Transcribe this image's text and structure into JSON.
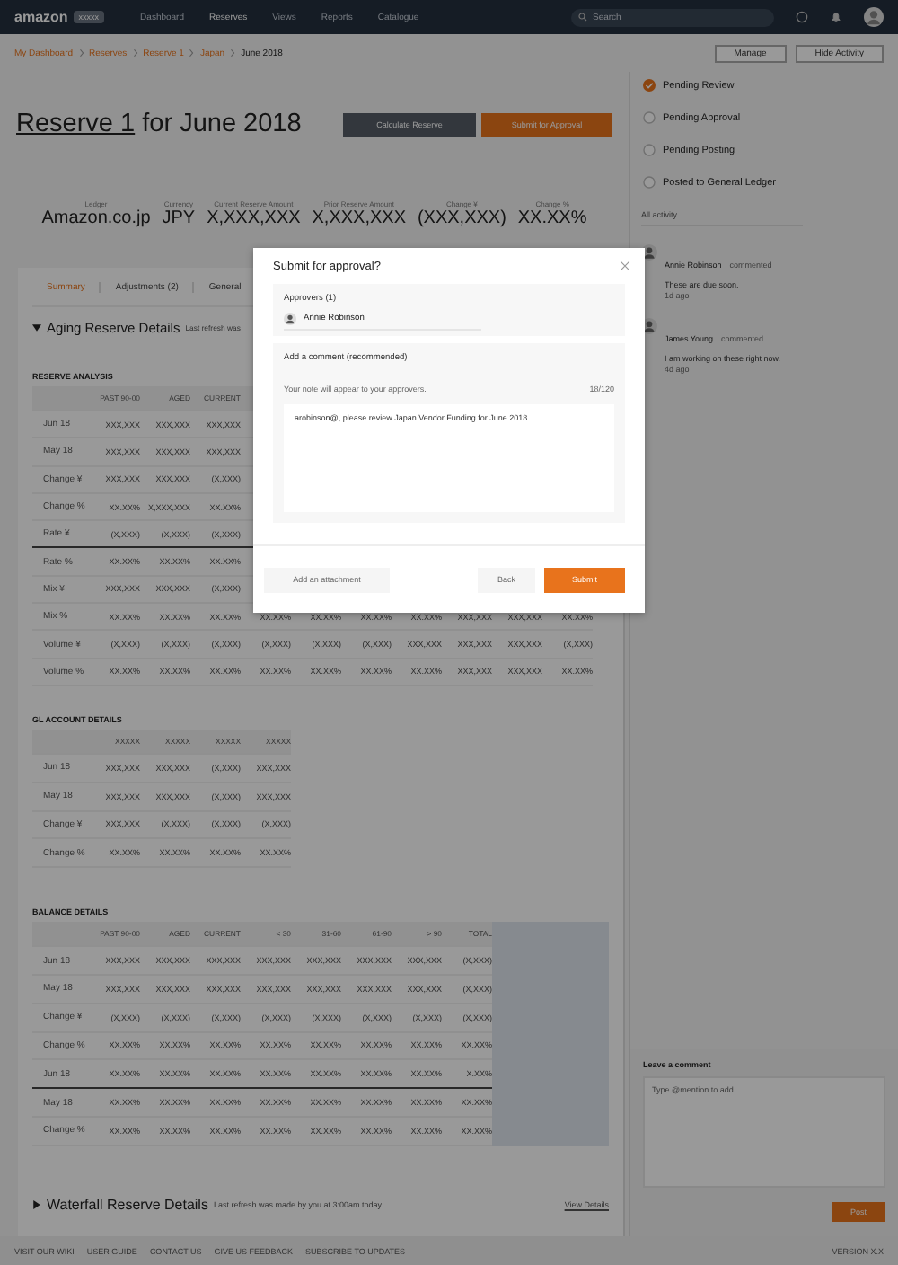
{
  "nav": {
    "logo": "amazon",
    "logo_badge": "xxxxx",
    "items": [
      {
        "label": "Dashboard",
        "selected": false
      },
      {
        "label": "Reserves",
        "selected": true
      },
      {
        "label": "Views",
        "selected": false
      },
      {
        "label": "Reports",
        "selected": false
      },
      {
        "label": "Catalogue",
        "selected": false
      }
    ],
    "search": {
      "placeholder": "Search"
    }
  },
  "breadcrumb": [
    {
      "label": "My Dashboard"
    },
    {
      "label": "Reserves"
    },
    {
      "label": "Reserve 1"
    },
    {
      "label": "Japan"
    },
    {
      "label": "June 2018"
    }
  ],
  "toolbar_buttons": [
    "Manage",
    "Hide Activity"
  ],
  "title": {
    "link": "Reserve 1",
    "rest": "for June 2018"
  },
  "actions": [
    {
      "label": "Calculate Reserve",
      "kind": "secondary"
    },
    {
      "label": "Submit for Approval",
      "kind": "primary"
    }
  ],
  "stats": [
    {
      "label": "Ledger",
      "value": "Amazon.co.jp"
    },
    {
      "label": "Currency",
      "value": "JPY"
    },
    {
      "label": "Current Reserve Amount",
      "value": "X,XXX,XXX"
    },
    {
      "label": "Prior Reserve Amount",
      "value": "X,XXX,XXX"
    },
    {
      "label": "Change ¥",
      "value": "(XXX,XXX)"
    },
    {
      "label": "Change %",
      "value": "XX.XX%"
    }
  ],
  "tabs": [
    {
      "label": "Summary",
      "selected": true
    },
    {
      "label": "Adjustments (2)",
      "selected": false
    },
    {
      "label": "General",
      "selected": false
    }
  ],
  "aging": {
    "title": "Aging Reserve Details",
    "note": "Last refresh was"
  },
  "sections": [
    {
      "title": "RESERVE ANALYSIS",
      "shaded_panel": false,
      "columns": [
        "PAST 90-00",
        "AGED",
        "CURRENT"
      ],
      "rows": [
        {
          "label": "Jun 18",
          "divider": false,
          "cells": [
            "XXX,XXX",
            "XXX,XXX",
            "XXX,XXX"
          ]
        },
        {
          "label": "May 18",
          "divider": false,
          "cells": [
            "XXX,XXX",
            "XXX,XXX",
            "XXX,XXX"
          ]
        },
        {
          "label": "Change ¥",
          "divider": false,
          "cells": [
            "XXX,XXX",
            "XXX,XXX",
            "(X,XXX)"
          ]
        },
        {
          "label": "Change %",
          "divider": false,
          "cells": [
            "XX.XX%",
            "X,XXX,XXX",
            "XX.XX%"
          ]
        },
        {
          "label": "Rate ¥",
          "divider": true,
          "cells": [
            "(X,XXX)",
            "(X,XXX)",
            "(X,XXX)"
          ]
        },
        {
          "label": "Rate %",
          "divider": false,
          "cells": [
            "XX.XX%",
            "XX.XX%",
            "XX.XX%"
          ]
        },
        {
          "label": "Mix ¥",
          "divider": false,
          "cells": [
            "XXX,XXX",
            "XXX,XXX",
            "(X,XXX)"
          ]
        },
        {
          "label": "Mix %",
          "divider": false,
          "cells": [
            "XX.XX%",
            "XX.XX%",
            "XX.XX%",
            "XX.XX%",
            "XX.XX%",
            "XX.XX%",
            "XX.XX%",
            "XXX,XXX",
            "XXX,XXX",
            "XX.XX%"
          ]
        },
        {
          "label": "Volume ¥",
          "divider": false,
          "cells": [
            "(X,XXX)",
            "(X,XXX)",
            "(X,XXX)",
            "(X,XXX)",
            "(X,XXX)",
            "(X,XXX)",
            "XXX,XXX",
            "XXX,XXX",
            "XXX,XXX",
            "(X,XXX)"
          ]
        },
        {
          "label": "Volume %",
          "divider": false,
          "cells": [
            "XX.XX%",
            "XX.XX%",
            "XX.XX%",
            "XX.XX%",
            "XX.XX%",
            "XX.XX%",
            "XX.XX%",
            "XXX,XXX",
            "XXX,XXX",
            "XX.XX%"
          ]
        }
      ]
    },
    {
      "title": "GL ACCOUNT DETAILS",
      "shaded_panel": false,
      "columns": [
        "XXXXX",
        "XXXXX",
        "XXXXX",
        "XXXXX"
      ],
      "rows": [
        {
          "label": "Jun 18",
          "divider": false,
          "cells": [
            "XXX,XXX",
            "XXX,XXX",
            "(X,XXX)",
            "XXX,XXX"
          ]
        },
        {
          "label": "May 18",
          "divider": false,
          "cells": [
            "XXX,XXX",
            "XXX,XXX",
            "(X,XXX)",
            "XXX,XXX"
          ]
        },
        {
          "label": "Change ¥",
          "divider": false,
          "cells": [
            "XXX,XXX",
            "(X,XXX)",
            "(X,XXX)",
            "(X,XXX)"
          ]
        },
        {
          "label": "Change %",
          "divider": false,
          "cells": [
            "XX.XX%",
            "XX.XX%",
            "XX.XX%",
            "XX.XX%"
          ]
        }
      ]
    },
    {
      "title": "BALANCE DETAILS",
      "shaded_panel": true,
      "columns": [
        "PAST 90-00",
        "AGED",
        "CURRENT",
        "< 30",
        "31-60",
        "61-90",
        "> 90",
        "TOTAL"
      ],
      "rows": [
        {
          "label": "Jun 18",
          "divider": false,
          "cells": [
            "XXX,XXX",
            "XXX,XXX",
            "XXX,XXX",
            "XXX,XXX",
            "XXX,XXX",
            "XXX,XXX",
            "XXX,XXX",
            "(X,XXX)"
          ]
        },
        {
          "label": "May 18",
          "divider": false,
          "cells": [
            "XXX,XXX",
            "XXX,XXX",
            "XXX,XXX",
            "XXX,XXX",
            "XXX,XXX",
            "XXX,XXX",
            "XXX,XXX",
            "(X,XXX)"
          ]
        },
        {
          "label": "Change ¥",
          "divider": false,
          "cells": [
            "(X,XXX)",
            "(X,XXX)",
            "(X,XXX)",
            "(X,XXX)",
            "(X,XXX)",
            "(X,XXX)",
            "(X,XXX)",
            "(X,XXX)"
          ]
        },
        {
          "label": "Change %",
          "divider": false,
          "cells": [
            "XX.XX%",
            "XX.XX%",
            "XX.XX%",
            "XX.XX%",
            "XX.XX%",
            "XX.XX%",
            "XX.XX%",
            "XX.XX%"
          ]
        },
        {
          "label": "Jun 18",
          "divider": true,
          "cells": [
            "XX.XX%",
            "XX.XX%",
            "XX.XX%",
            "XX.XX%",
            "XX.XX%",
            "XX.XX%",
            "XX.XX%",
            "X.XX%"
          ]
        },
        {
          "label": "May 18",
          "divider": false,
          "cells": [
            "XX.XX%",
            "XX.XX%",
            "XX.XX%",
            "XX.XX%",
            "XX.XX%",
            "XX.XX%",
            "XX.XX%",
            "XX.XX%"
          ]
        },
        {
          "label": "Change %",
          "divider": false,
          "cells": [
            "XX.XX%",
            "XX.XX%",
            "XX.XX%",
            "XX.XX%",
            "XX.XX%",
            "XX.XX%",
            "XX.XX%",
            "XX.XX%"
          ]
        }
      ]
    }
  ],
  "waterfall": {
    "title": "Waterfall Reserve Details",
    "note": "Last refresh was made by you at 3:00am today",
    "link": "View Details"
  },
  "footer": {
    "links": [
      "VISIT OUR WIKI",
      "USER GUIDE",
      "CONTACT US",
      "GIVE US FEEDBACK",
      "SUBSCRIBE TO UPDATES"
    ],
    "version": "VERSION X.X"
  },
  "steps": [
    {
      "label": "Pending Review",
      "done": true
    },
    {
      "label": "Pending Approval",
      "done": false
    },
    {
      "label": "Pending Posting",
      "done": false
    },
    {
      "label": "Posted to General Ledger",
      "done": false
    }
  ],
  "activity_filter": "All activity",
  "comments": [
    {
      "author": "Annie Robinson",
      "action": "commented",
      "text": "These are due soon.",
      "time": "1d ago"
    },
    {
      "author": "James Young",
      "action": "commented",
      "text": "I am working on these right now.",
      "time": "4d ago"
    }
  ],
  "leave_comment": {
    "label": "Leave a comment",
    "placeholder": "Type @mention to add...",
    "button": "Post"
  },
  "modal": {
    "title": "Submit for approval?",
    "approvers_label": "Approvers (1)",
    "approvers": [
      "Annie Robinson"
    ],
    "comment_label": "Add a comment (recommended)",
    "hint": "Your note will appear to your approvers.",
    "counter": "18/120",
    "comment": "arobinson@, please review Japan Vendor Funding for June 2018.",
    "attach": "Add an attachment",
    "back": "Back",
    "submit": "Submit"
  }
}
